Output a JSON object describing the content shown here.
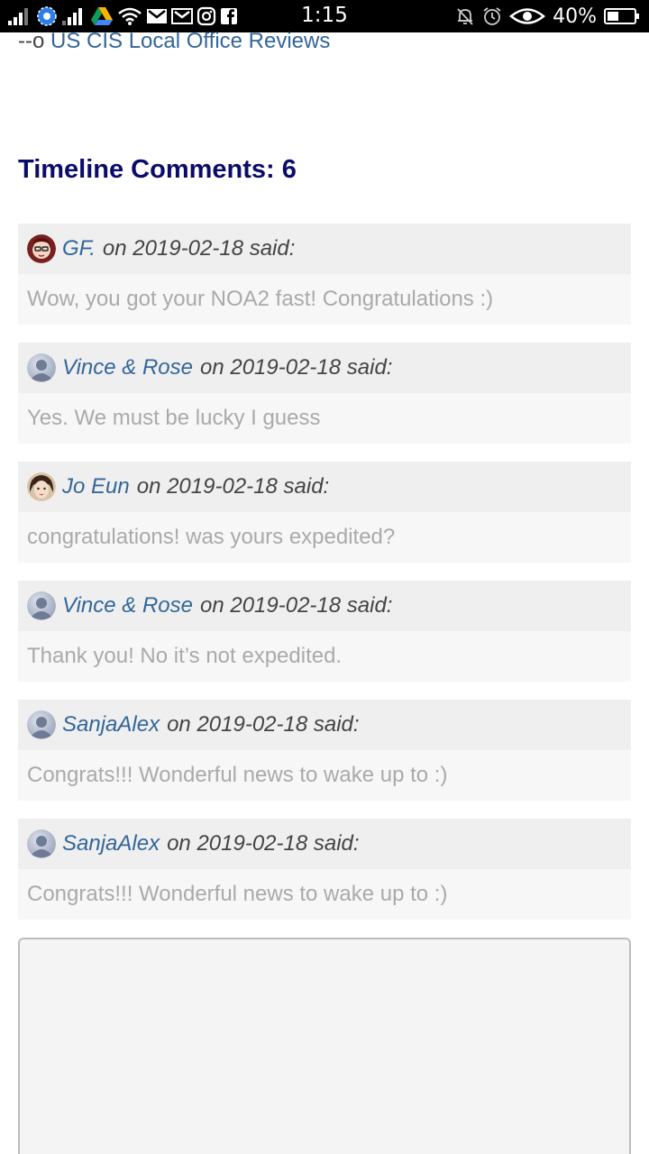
{
  "status_bar": {
    "time": "1:15",
    "battery_percent": "40%",
    "left_icons": [
      "signal-icon",
      "vpn-globe-icon",
      "signal-icon",
      "drive-icon",
      "wifi-icon",
      "gmail-icon",
      "gmail-icon",
      "instagram-icon",
      "facebook-icon"
    ],
    "right_icons": [
      "mute-bell-icon",
      "alarm-icon",
      "eye-icon",
      "battery-icon"
    ]
  },
  "top_link": {
    "prefix": "--o",
    "label": "US CIS Local Office Reviews"
  },
  "comments_section": {
    "title": "Timeline Comments: 6",
    "comments": [
      {
        "author": "GF.",
        "meta": "on 2019-02-18 said:",
        "text": "Wow, you got your NOA2 fast! Congratulations :)",
        "avatar": "gf-avatar"
      },
      {
        "author": "Vince & Rose",
        "meta": "on 2019-02-18 said:",
        "text": "Yes. We must be lucky I guess",
        "avatar": "default-avatar"
      },
      {
        "author": "Jo Eun",
        "meta": "on 2019-02-18 said:",
        "text": "congratulations! was yours expedited?",
        "avatar": "jo-avatar"
      },
      {
        "author": "Vince & Rose",
        "meta": "on 2019-02-18 said:",
        "text": "Thank you! No it’s not expedited.",
        "avatar": "default-avatar"
      },
      {
        "author": "SanjaAlex",
        "meta": "on 2019-02-18 said:",
        "text": "Congrats!!! Wonderful news to wake up to :)",
        "avatar": "default-avatar"
      },
      {
        "author": "SanjaAlex",
        "meta": "on 2019-02-18 said:",
        "text": "Congrats!!! Wonderful news to wake up to :)",
        "avatar": "default-avatar"
      }
    ]
  },
  "reply_box": {
    "value": "",
    "placeholder": ""
  },
  "colors": {
    "link": "#336699",
    "heading": "#0b0b6b",
    "comment_head_bg": "#efefef",
    "comment_body_bg": "#f7f7f7",
    "comment_text": "#aaaaaa"
  }
}
